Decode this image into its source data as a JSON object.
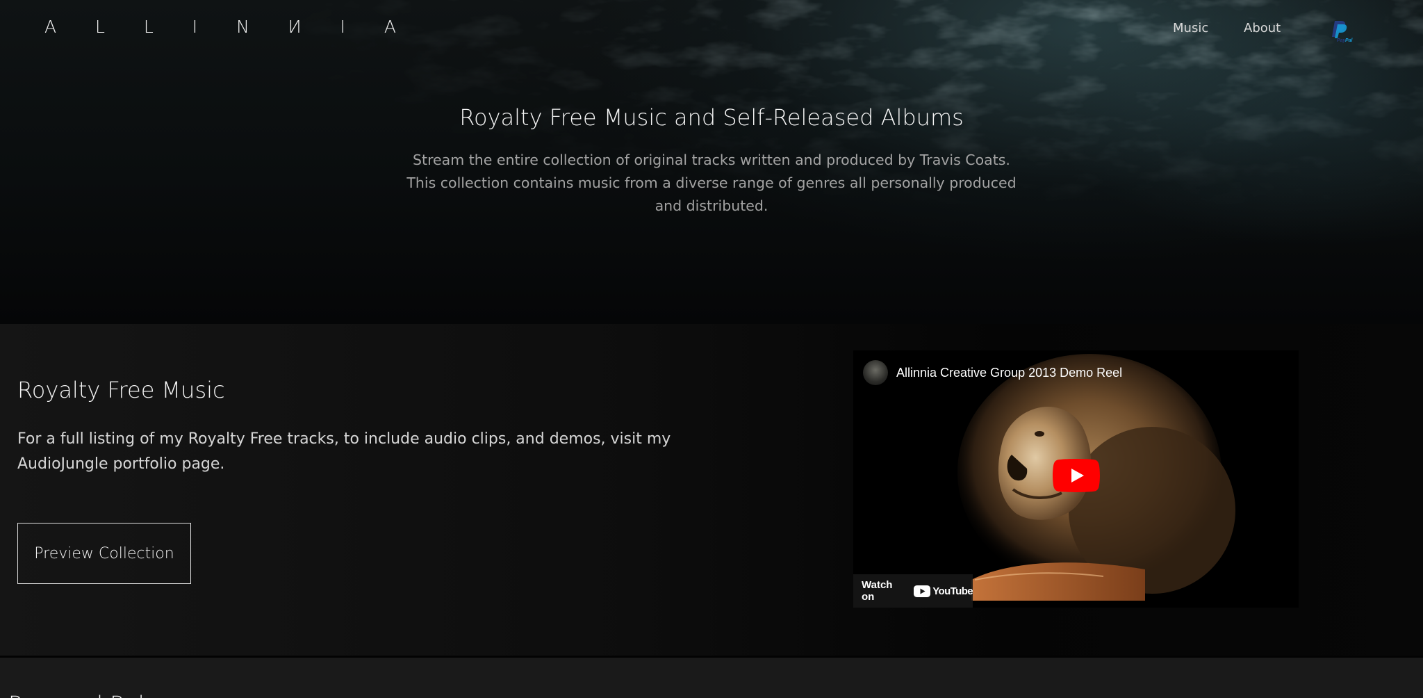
{
  "header": {
    "logo": "A L L I N И I A",
    "nav": [
      {
        "label": "Music"
      },
      {
        "label": "About"
      }
    ],
    "paypal_icon": "paypal-icon"
  },
  "hero": {
    "title": "Royalty Free Music and Self-Released Albums",
    "subtitle": "Stream the entire collection of original tracks written and produced by Travis Coats. This collection contains music from a diverse range of genres all personally produced and distributed."
  },
  "royalty_free": {
    "title": "Royalty Free Music",
    "description": "For a full listing of my Royalty Free tracks, to include audio clips, and demos, visit my AudioJungle portfolio page.",
    "button_label": "Preview Collection"
  },
  "video": {
    "title": "Allinnia Creative Group 2013 Demo Reel",
    "watch_label": "Watch on",
    "platform": "YouTube",
    "play_icon": "youtube-play-icon"
  },
  "next_section": {
    "title": "Personal Releases"
  },
  "colors": {
    "background": "#0b0b0b",
    "youtube_red": "#ff0000",
    "paypal_dark": "#253b80",
    "paypal_light": "#179bd7"
  }
}
